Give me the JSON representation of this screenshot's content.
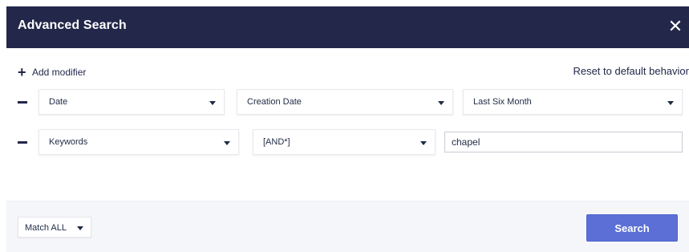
{
  "dialog": {
    "title": "Advanced Search",
    "close_icon": "close-icon"
  },
  "toolbar": {
    "add_modifier_label": "Add modifier",
    "add_modifier_icon": "plus-icon",
    "reset_label": "Reset to default behavior"
  },
  "rows": [
    {
      "remove_icon": "minus-icon",
      "field": "Date",
      "operator": "Creation Date",
      "value": "Last Six Month"
    },
    {
      "remove_icon": "minus-icon",
      "field": "Keywords",
      "operator": "[AND*]",
      "value": "chapel"
    }
  ],
  "footer": {
    "match_label": "Match ALL",
    "search_label": "Search"
  },
  "colors": {
    "header_bg": "#23284a",
    "accent": "#5b6fd6",
    "footer_bg": "#f5f6fa"
  }
}
